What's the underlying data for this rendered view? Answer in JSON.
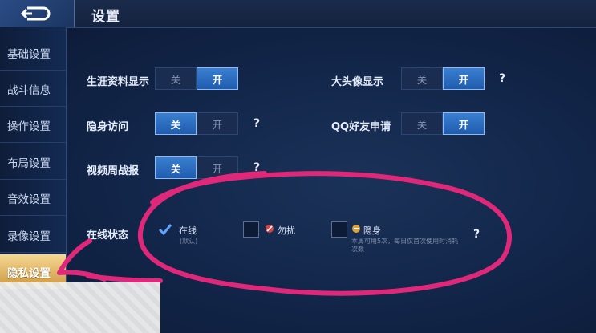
{
  "header": {
    "title": "设置"
  },
  "sidebar": {
    "items": [
      {
        "label": "基础设置"
      },
      {
        "label": "战斗信息"
      },
      {
        "label": "操作设置"
      },
      {
        "label": "布局设置"
      },
      {
        "label": "音效设置"
      },
      {
        "label": "录像设置"
      },
      {
        "label": "隐私设置"
      }
    ]
  },
  "settings": {
    "career_display": {
      "label": "生涯资料显示",
      "off": "关",
      "on": "开"
    },
    "big_avatar": {
      "label": "大头像显示",
      "off": "关",
      "on": "开",
      "help": "?"
    },
    "stealth_visit": {
      "label": "隐身访问",
      "off": "关",
      "on": "开",
      "help": "?"
    },
    "qq_friend_request": {
      "label": "QQ好友申请",
      "off": "关",
      "on": "开"
    },
    "video_weekly": {
      "label": "视频周战报",
      "off": "关",
      "on": "开",
      "help": "?"
    }
  },
  "online_status": {
    "label": "在线状态",
    "options": [
      {
        "label": "在线",
        "sub": "(默认)"
      },
      {
        "label": "勿扰"
      },
      {
        "label": "隐身",
        "sub": "本周可用5次，每日仅首次使用时消耗次数"
      }
    ],
    "help": "?"
  },
  "colors": {
    "accent_blue": "#2f6fc5",
    "active_gold": "#e8bf6a",
    "annotation_pink": "#e0287a"
  }
}
